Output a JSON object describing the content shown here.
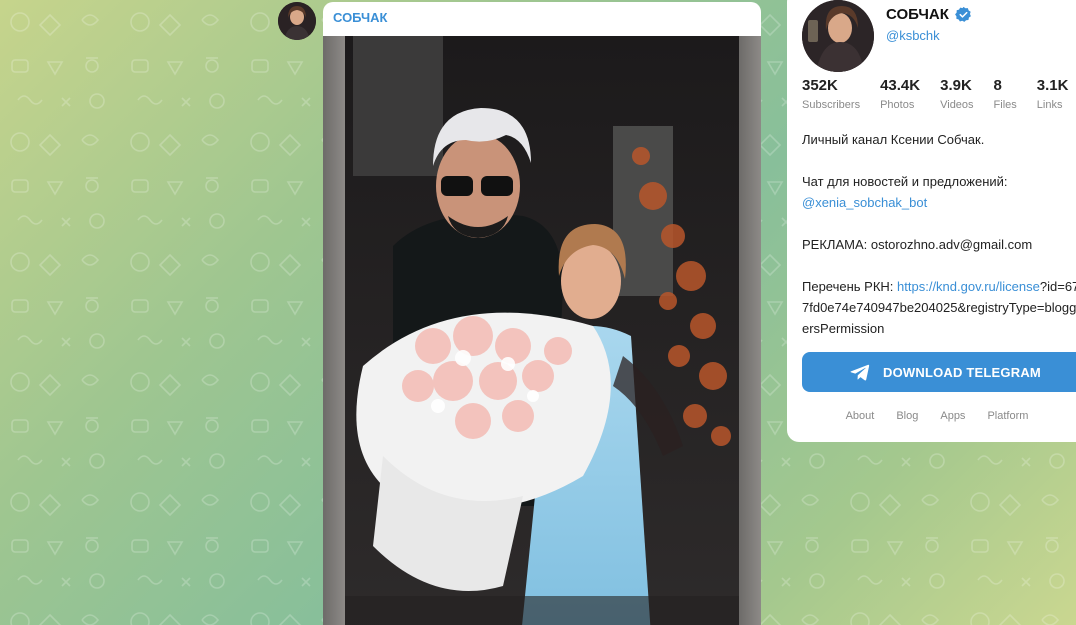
{
  "post": {
    "author": "СОБЧАК"
  },
  "profile": {
    "name": "СОБЧАК",
    "handle": "@ksbchk",
    "stats": [
      {
        "value": "352K",
        "label": "Subscribers"
      },
      {
        "value": "43.4K",
        "label": "Photos"
      },
      {
        "value": "3.9K",
        "label": "Videos"
      },
      {
        "value": "8",
        "label": "Files"
      },
      {
        "value": "3.1K",
        "label": "Links"
      }
    ],
    "description": {
      "line1": "Личный канал Ксении Собчак.",
      "chat_label": "Чат для новостей и предложений:",
      "chat_bot": "@xenia_sobchak_bot",
      "ads": "РЕКЛАМА: ostorozhno.adv@gmail.com",
      "rkn_label": "Перечень РКН: ",
      "rkn_link": "https://knd.gov.ru/license",
      "rkn_rest": "?id=677fd0e74e740947be204025&registryType=bloggersPermission"
    }
  },
  "download_button": "DOWNLOAD TELEGRAM",
  "footer_links": [
    "About",
    "Blog",
    "Apps",
    "Platform"
  ],
  "colors": {
    "accent": "#3a8fd6",
    "background_start": "#c6d48c",
    "background_end": "#88bf9a"
  }
}
